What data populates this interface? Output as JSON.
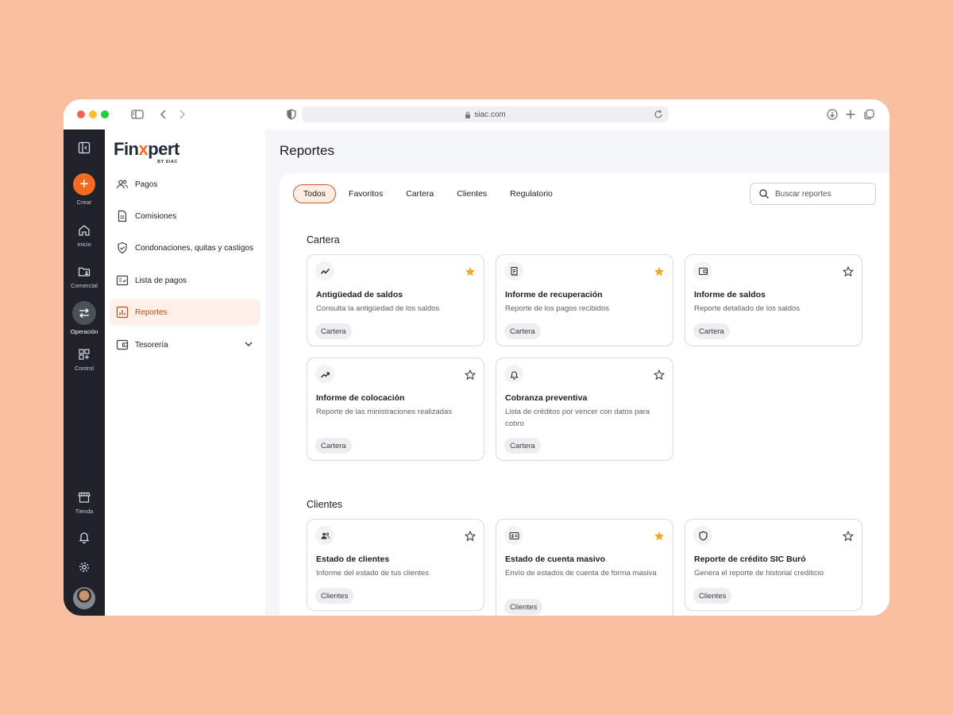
{
  "browser": {
    "url": "siac.com"
  },
  "rail": {
    "create": "Crear",
    "items": [
      {
        "label": "Inicio"
      },
      {
        "label": "Comercial"
      },
      {
        "label": "Operación"
      },
      {
        "label": "Control"
      },
      {
        "label": "Tienda"
      }
    ]
  },
  "sidebar": {
    "logo_text_1": "Fin",
    "logo_text_x": "x",
    "logo_text_2": "pert",
    "logo_sub": "BY SIAC",
    "items": [
      {
        "label": "Pagos"
      },
      {
        "label": "Comisiones"
      },
      {
        "label": "Condonaciones, quitas y castigos"
      },
      {
        "label": "Lista de pagos"
      },
      {
        "label": "Reportes"
      },
      {
        "label": "Tesorería"
      }
    ]
  },
  "main": {
    "title": "Reportes",
    "tabs": [
      {
        "label": "Todos"
      },
      {
        "label": "Favoritos"
      },
      {
        "label": "Cartera"
      },
      {
        "label": "Clientes"
      },
      {
        "label": "Regulatorio"
      }
    ],
    "search_placeholder": "Buscar reportes",
    "accent_color": "#f26b21",
    "star_color": "#f5a623",
    "sections": [
      {
        "title": "Cartera",
        "cards": [
          {
            "icon": "trending-icon",
            "title": "Antigüedad de saldos",
            "desc": "Consulta la antigüedad de los saldos",
            "tag": "Cartera",
            "favorite": true
          },
          {
            "icon": "receipt-icon",
            "title": "Informe de recuperación",
            "desc": "Reporte de los pagos recibidos",
            "tag": "Cartera",
            "favorite": true
          },
          {
            "icon": "wallet-icon",
            "title": "Informe de saldos",
            "desc": "Reporte detallado de los saldos",
            "tag": "Cartera",
            "favorite": false
          },
          {
            "icon": "trending-up-icon",
            "title": "Informe de colocación",
            "desc": "Reporte de las ministraciones realizadas",
            "tag": "Cartera",
            "favorite": false
          },
          {
            "icon": "bell-icon",
            "title": "Cobranza preventiva",
            "desc": "Lista de créditos por vencer con datos para cobro",
            "tag": "Cartera",
            "favorite": false
          }
        ]
      },
      {
        "title": "Clientes",
        "cards": [
          {
            "icon": "people-icon",
            "title": "Estado de clientes",
            "desc": "Informe del estado de tus clientes",
            "tag": "Clientes",
            "favorite": false
          },
          {
            "icon": "id-card-icon",
            "title": "Estado de cuenta masivo",
            "desc": "Envío de estados de cuenta de forma masiva",
            "tag": "Clientes",
            "favorite": true
          },
          {
            "icon": "shield-icon",
            "title": "Reporte de crédito SIC Buró",
            "desc": "Genera el reporte de historial crediticio",
            "tag": "Clientes",
            "favorite": false
          }
        ]
      }
    ]
  }
}
